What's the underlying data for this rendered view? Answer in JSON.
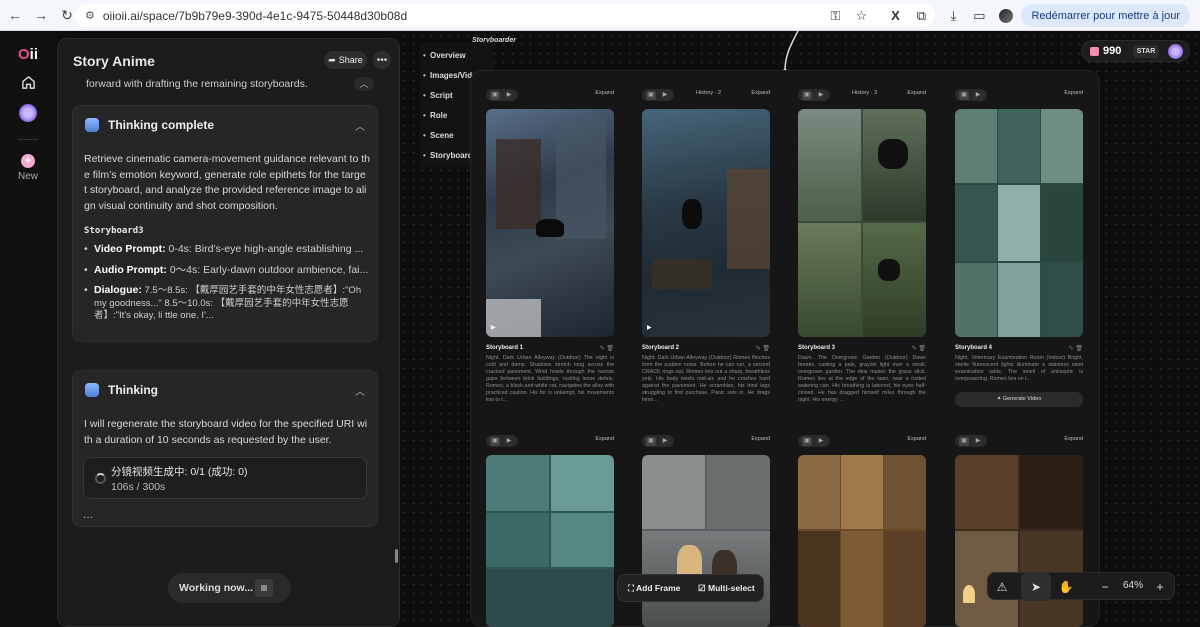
{
  "browser": {
    "url": "oiioii.ai/space/7b9b79e9-390d-4e1c-9475-50448d30b08d",
    "restart_label": "Redémarrer pour mettre à jour"
  },
  "rail": {
    "logo_a": "O",
    "logo_b": "ii",
    "new_label": "New"
  },
  "chat": {
    "title": "Story Anime",
    "share_label": "Share",
    "prev_text": "forward with drafting the remaining storyboards.",
    "card1": {
      "title": "Thinking complete",
      "body": "Retrieve cinematic camera-movement guidance relevant to th e film’s emotion keyword, generate role epithets for the targe t storyboard, and analyze the provided reference image to ali gn visual continuity and shot composition.",
      "section": "Storyboard3",
      "video_label": "Video Prompt:",
      "video_text": " 0-4s: Bird’s-eye high-angle establishing ...",
      "audio_label": "Audio Prompt:",
      "audio_text": " 0～4s: Early-dawn outdoor ambience, fai...",
      "dialogue_label": "Dialogue:",
      "dialogue_text": " 7.5～8.5s: 【戴厚园艺手套的中年女性志愿者】:\"Oh my goodness...\" 8.5～10.0s: 【戴厚园艺手套的中年女性志愿者】:\"It's okay, li ttle one. I'..."
    },
    "card2": {
      "title": "Thinking",
      "body": "I will regenerate the storyboard video for the specified URI wi th a duration of 10 seconds as requested by the user.",
      "progress_title": "分镜视频生成中: 0/1 (成功: 0)",
      "progress_time": "106s / 300s",
      "dots": "..."
    },
    "working_label": "Working now..."
  },
  "toc": {
    "items": [
      "Overview",
      "Images/Videos",
      "Script",
      "Role",
      "Scene",
      "Storyboard"
    ],
    "section_label": "Storyboarder"
  },
  "score": {
    "value": "990",
    "badge": "STAR"
  },
  "storyboards": [
    {
      "name": "Storyboard 1",
      "history": "",
      "expand": "Expand",
      "desc": "Night. Dark Urban Alleyway (Outdoor) The night is cold and damp. Shadows stretch long across the cracked pavement. Wind howls through the narrow gaps between brick buildings, rustling loose debris. Romeo, a black-and-white cat, navigates the alley with practiced caution. His fur is unkempt, his movements low to t..."
    },
    {
      "name": "Storyboard 2",
      "history": "History · 2",
      "expand": "Expand",
      "desc": "Night. Dark Urban Alleyway (Outdoor) Romeo flinches from the sudden noise. Before he can run, a second CRACK rings out. Romeo lets out a sharp, breathless yelp. His body twists mid-air, and he crashes hard against the pavement. He scrambles, his hind legs struggling to find purchase. Panic sets in. He drags hims..."
    },
    {
      "name": "Storyboard 3",
      "history": "History · 3",
      "expand": "Expand",
      "desc": "Dawn. The Overgrown Garden (Outdoor) Dawn breaks, casting a pale, grayish light over a small, overgrown garden. The dew makes the grass slick. Romeo lies at the edge of the lawn, near a rusted watering can. His breathing is labored, his eyes half-closed. He has dragged himself miles through the night. His energy ..."
    },
    {
      "name": "Storyboard 4",
      "history": "",
      "expand": "Expand",
      "desc": "Night. Veterinary Examination Room (Indoor) Bright, sterile fluorescent lights illuminate a stainless steel examination table. The smell of antiseptic is overpowering. Romeo lies on t...",
      "action": "Generate Video"
    }
  ],
  "row2_expand": [
    "Expand",
    "Expand",
    "Expand",
    "Expand"
  ],
  "bottom_bar": {
    "add_frame": "Add Frame",
    "multi_select": "Multi-select"
  },
  "zoom": {
    "value": "64%",
    "minus": "−",
    "plus": "+"
  }
}
